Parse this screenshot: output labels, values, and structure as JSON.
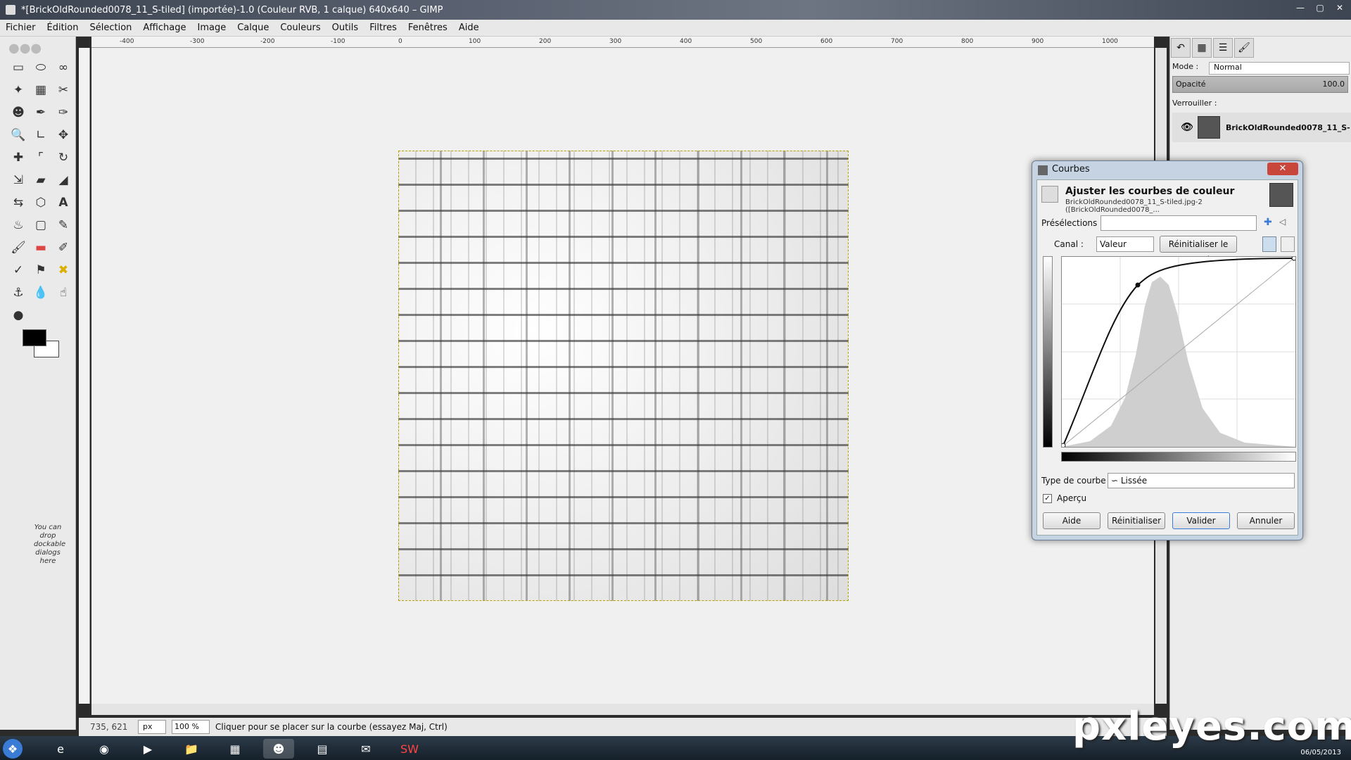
{
  "window": {
    "title": "*[BrickOldRounded0078_11_S-tiled] (importée)-1.0 (Couleur RVB, 1 calque) 640x640 – GIMP"
  },
  "menu": [
    "Fichier",
    "Édition",
    "Sélection",
    "Affichage",
    "Image",
    "Calque",
    "Couleurs",
    "Outils",
    "Filtres",
    "Fenêtres",
    "Aide"
  ],
  "ruler_top": [
    "-400",
    "-300",
    "-200",
    "-100",
    "0",
    "100",
    "200",
    "300",
    "400",
    "500",
    "600",
    "700",
    "800",
    "900",
    "1000"
  ],
  "toolbox": {
    "tools": [
      "rect-select",
      "ellipse-select",
      "free-select",
      "fuzzy-select",
      "color-select",
      "scissors",
      "foreground-select",
      "paths",
      "color-picker",
      "zoom",
      "measure",
      "move",
      "align",
      "crop",
      "rotate",
      "scale",
      "shear",
      "perspective",
      "flip",
      "cage",
      "text",
      "bucket-fill",
      "blend",
      "pencil",
      "paintbrush",
      "eraser",
      "airbrush",
      "ink",
      "clone",
      "heal",
      "perspective-clone",
      "blur",
      "smudge",
      "dodge"
    ],
    "drop_hint": "You can drop dockable dialogs here"
  },
  "status": {
    "coords": "735, 621",
    "unit": "px",
    "zoom": "100 %",
    "message": "Cliquer pour se placer sur la courbe (essayez Maj, Ctrl)"
  },
  "layers_panel": {
    "mode_label": "Mode :",
    "mode_value": "Normal",
    "opacity_label": "Opacité",
    "opacity_value": "100.0",
    "lock_label": "Verrouiller :",
    "layer_name": "BrickOldRounded0078_11_S-"
  },
  "curves_dialog": {
    "title": "Courbes",
    "heading": "Ajuster les courbes de couleur",
    "subheading": "BrickOldRounded0078_11_S-tiled.jpg-2 ([BrickOldRounded0078_...",
    "presets_label": "Présélections :",
    "channel_label": "Canal :",
    "channel_value": "Valeur",
    "reset_channel": "Réinitialiser le canal",
    "curve_type_label": "Type de courbe :",
    "curve_type_value": "Lissée",
    "preview_label": "Aperçu",
    "preview_checked": true,
    "buttons": {
      "help": "Aide",
      "reset": "Réinitialiser",
      "ok": "Valider",
      "cancel": "Annuler"
    }
  },
  "taskbar": {
    "date": "06/05/2013"
  },
  "watermark": "pxleyes.com"
}
